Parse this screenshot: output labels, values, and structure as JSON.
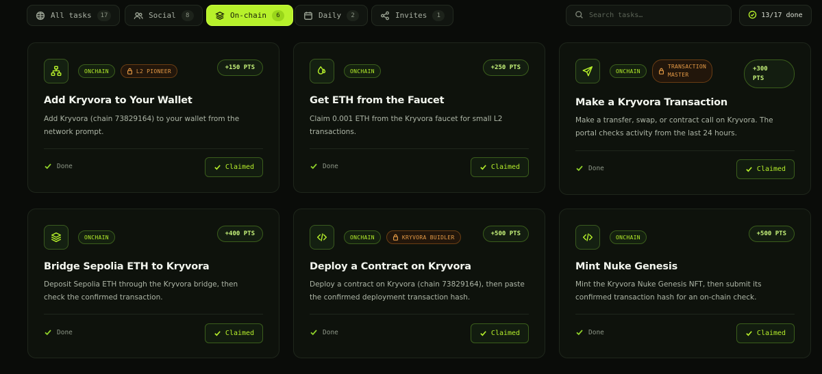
{
  "tabs": [
    {
      "label": "All tasks",
      "count": "17",
      "icon": "grid-icon"
    },
    {
      "label": "Social",
      "count": "8",
      "icon": "users-icon"
    },
    {
      "label": "On-chain",
      "count": "6",
      "icon": "layers-icon",
      "active": true
    },
    {
      "label": "Daily",
      "count": "2",
      "icon": "calendar-icon"
    },
    {
      "label": "Invites",
      "count": "1",
      "icon": "share-icon"
    }
  ],
  "search": {
    "placeholder": "Search tasks…"
  },
  "progress": {
    "label": "13/17 done",
    "completed": 13,
    "total": 17
  },
  "accent_color": "#b7f12b",
  "cards": [
    {
      "icon": "network-icon",
      "tag": "ONCHAIN",
      "achievement": "L2 PIONEER",
      "points": "+150 PTS",
      "title": "Add Kryvora to Your Wallet",
      "description": "Add Kryvora (chain 73829164) to your wallet from the network prompt.",
      "status": "Done",
      "action": "Claimed"
    },
    {
      "icon": "faucet-icon",
      "tag": "ONCHAIN",
      "achievement": "",
      "points": "+250 PTS",
      "title": "Get ETH from the Faucet",
      "description": "Claim 0.001 ETH from the Kryvora faucet for small L2 transactions.",
      "status": "Done",
      "action": "Claimed"
    },
    {
      "icon": "send-icon",
      "tag": "ONCHAIN",
      "achievement": "TRANSACTION\nMASTER",
      "points": "+300\nPTS",
      "title": "Make a Kryvora Transaction",
      "description": "Make a transfer, swap, or contract call on Kryvora. The portal checks activity from the last 24 hours.",
      "status": "Done",
      "action": "Claimed"
    },
    {
      "icon": "layers-icon",
      "tag": "ONCHAIN",
      "achievement": "",
      "points": "+400 PTS",
      "title": "Bridge Sepolia ETH to Kryvora",
      "description": "Deposit Sepolia ETH through the Kryvora bridge, then check the confirmed transaction.",
      "status": "Done",
      "action": "Claimed"
    },
    {
      "icon": "code-icon",
      "tag": "ONCHAIN",
      "achievement": "KRYVORA BUIDLER",
      "points": "+500 PTS",
      "title": "Deploy a Contract on Kryvora",
      "description": "Deploy a contract on Kryvora (chain 73829164), then paste the confirmed deployment transaction hash.",
      "status": "Done",
      "action": "Claimed"
    },
    {
      "icon": "code-icon",
      "tag": "ONCHAIN",
      "achievement": "",
      "points": "+500 PTS",
      "title": "Mint Nuke Genesis",
      "description": "Mint the Kryvora Nuke Genesis NFT, then submit its confirmed transaction hash for an on-chain check.",
      "status": "Done",
      "action": "Claimed"
    }
  ]
}
